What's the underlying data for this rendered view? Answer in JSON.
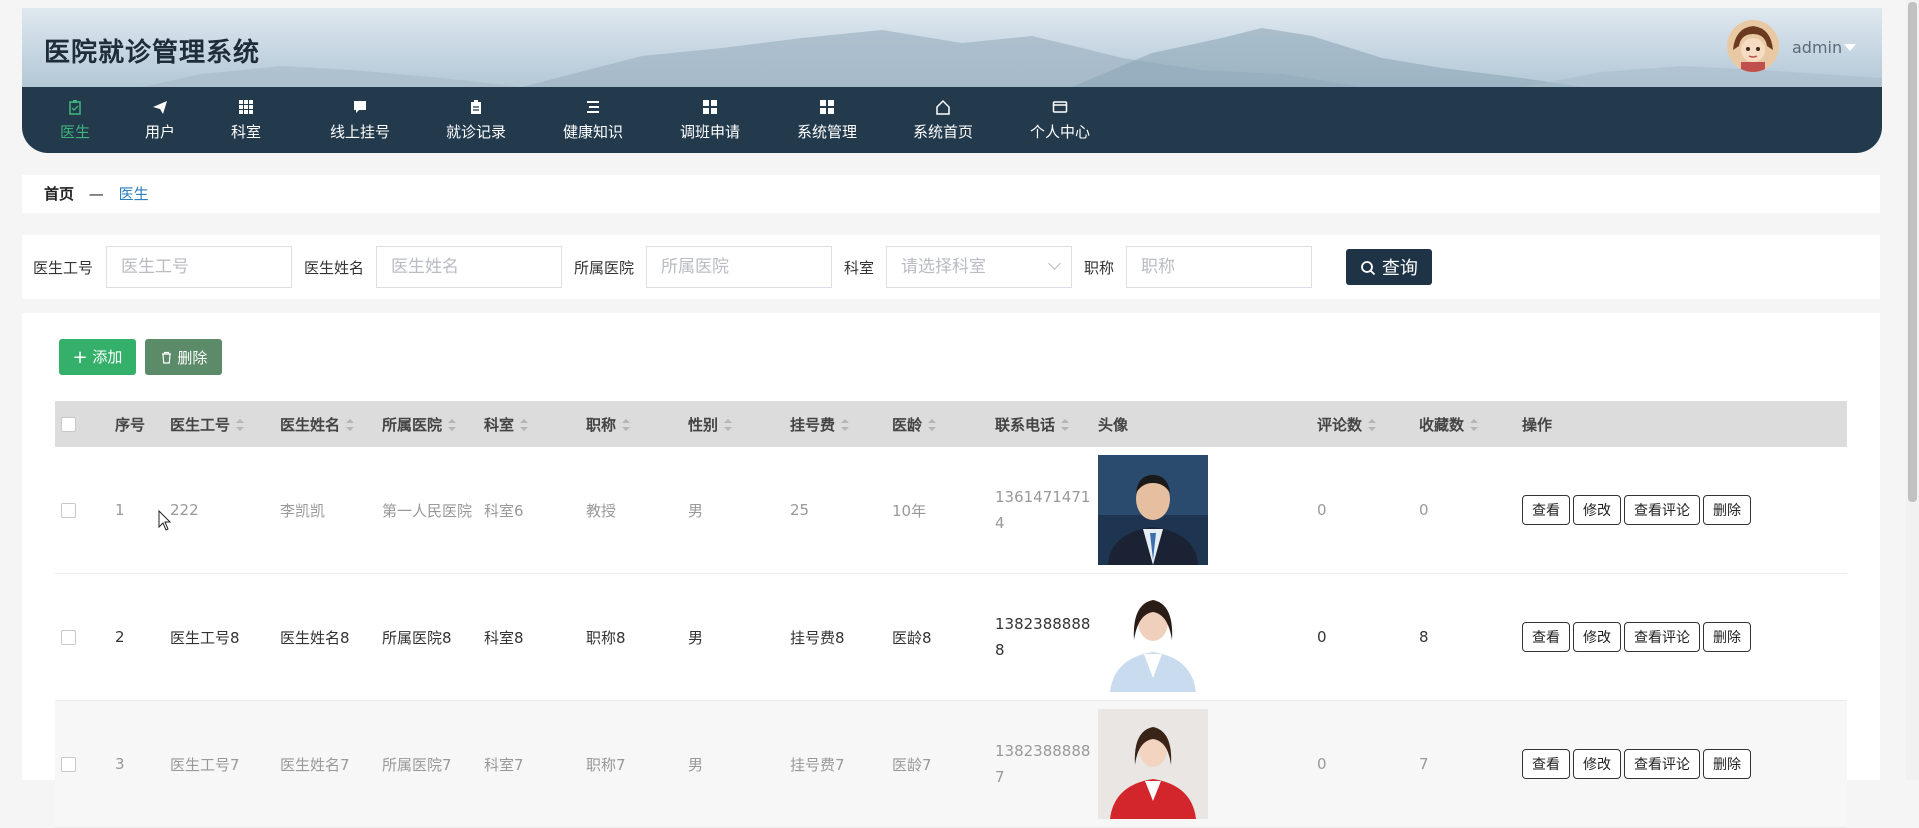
{
  "header": {
    "app_title": "医院就诊管理系统",
    "username": "admin"
  },
  "nav": [
    {
      "label": "医生",
      "icon": "clipboard-icon",
      "active": true
    },
    {
      "label": "用户",
      "icon": "send-icon",
      "active": false
    },
    {
      "label": "科室",
      "icon": "grid-icon",
      "active": false
    },
    {
      "label": "线上挂号",
      "icon": "chat-icon",
      "active": false
    },
    {
      "label": "就诊记录",
      "icon": "clipboard-icon",
      "active": false
    },
    {
      "label": "健康知识",
      "icon": "list-icon",
      "active": false
    },
    {
      "label": "调班申请",
      "icon": "grid-icon",
      "active": false
    },
    {
      "label": "系统管理",
      "icon": "grid-icon",
      "active": false
    },
    {
      "label": "系统首页",
      "icon": "home-icon",
      "active": false
    },
    {
      "label": "个人中心",
      "icon": "card-icon",
      "active": false
    }
  ],
  "breadcrumb": {
    "home": "首页",
    "separator": "—",
    "current": "医生"
  },
  "search": {
    "fields": [
      {
        "label": "医生工号",
        "placeholder": "医生工号"
      },
      {
        "label": "医生姓名",
        "placeholder": "医生姓名"
      },
      {
        "label": "所属医院",
        "placeholder": "所属医院"
      },
      {
        "label": "科室",
        "placeholder": "请选择科室"
      },
      {
        "label": "职称",
        "placeholder": "职称"
      }
    ],
    "query_label": "查询"
  },
  "toolbar": {
    "add_label": "添加",
    "delete_label": "删除"
  },
  "table": {
    "columns": [
      "序号",
      "医生工号",
      "医生姓名",
      "所属医院",
      "科室",
      "职称",
      "性别",
      "挂号费",
      "医龄",
      "联系电话",
      "头像",
      "评论数",
      "收藏数",
      "操作"
    ],
    "actions": [
      "查看",
      "修改",
      "查看评论",
      "删除"
    ],
    "rows": [
      {
        "index": "1",
        "id": "222",
        "name": "李凯凯",
        "hospital": "第一人民医院",
        "dept": "科室6",
        "title": "教授",
        "gender": "男",
        "fee": "25",
        "years": "10年",
        "phone": "13614714714",
        "comments": "0",
        "favorites": "0"
      },
      {
        "index": "2",
        "id": "医生工号8",
        "name": "医生姓名8",
        "hospital": "所属医院8",
        "dept": "科室8",
        "title": "职称8",
        "gender": "男",
        "fee": "挂号费8",
        "years": "医龄8",
        "phone": "13823888888",
        "comments": "0",
        "favorites": "8"
      },
      {
        "index": "3",
        "id": "医生工号7",
        "name": "医生姓名7",
        "hospital": "所属医院7",
        "dept": "科室7",
        "title": "职称7",
        "gender": "男",
        "fee": "挂号费7",
        "years": "医龄7",
        "phone": "13823888887",
        "comments": "0",
        "favorites": "7"
      }
    ]
  },
  "colors": {
    "nav_bg": "#223a4c",
    "active": "#3fb17a",
    "add": "#35b06b",
    "delete": "#5b8b68",
    "query": "#1e3345"
  }
}
